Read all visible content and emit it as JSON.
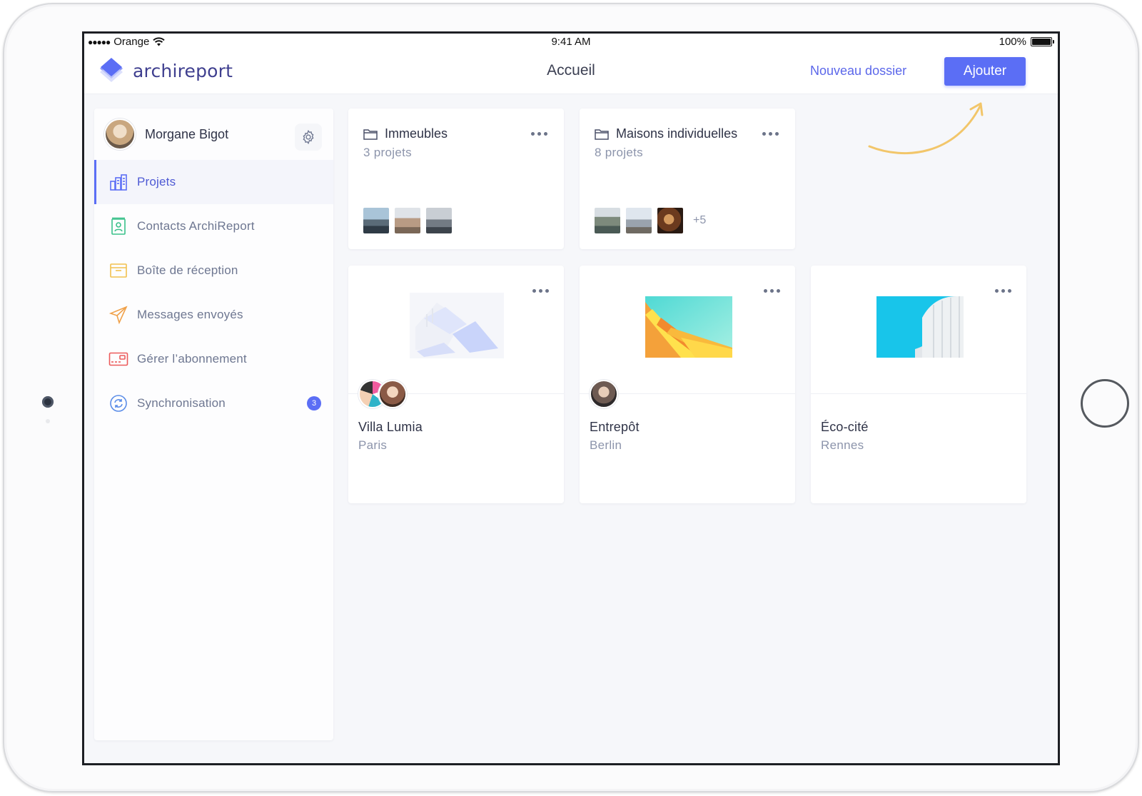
{
  "status_bar": {
    "carrier": "Orange",
    "time": "9:41 AM",
    "battery": "100%",
    "battery_level": 1.0
  },
  "navbar": {
    "logo_text": "archireport",
    "title": "Accueil",
    "new_folder_label": "Nouveau dossier",
    "add_label": "Ajouter"
  },
  "sidebar": {
    "user_name": "Morgane Bigot",
    "items": [
      {
        "label": "Projets",
        "icon": "buildings-icon",
        "color": "#5b6ef5",
        "active": true
      },
      {
        "label": "Contacts ArchiReport",
        "icon": "contacts-icon",
        "color": "#3ac18a"
      },
      {
        "label": "Boîte de réception",
        "icon": "inbox-icon",
        "color": "#f2c14e"
      },
      {
        "label": "Messages envoyés",
        "icon": "send-icon",
        "color": "#f0a14a"
      },
      {
        "label": "Gérer l’abonnement",
        "icon": "credit-card-icon",
        "color": "#ec5b5b"
      },
      {
        "label": "Synchronisation",
        "icon": "sync-icon",
        "color": "#5b8de8",
        "badge": "3"
      }
    ]
  },
  "folders": [
    {
      "title": "Immeubles",
      "subtitle": "3 projets"
    },
    {
      "title": "Maisons individuelles",
      "subtitle": "8 projets",
      "more": "+5"
    }
  ],
  "projects": [
    {
      "name": "Villa Lumia",
      "city": "Paris"
    },
    {
      "name": "Entrepôt",
      "city": "Berlin"
    },
    {
      "name": "Éco-cité",
      "city": "Rennes"
    }
  ],
  "colors": {
    "accent": "#5b6ef5",
    "arrow": "#f2c66a"
  }
}
